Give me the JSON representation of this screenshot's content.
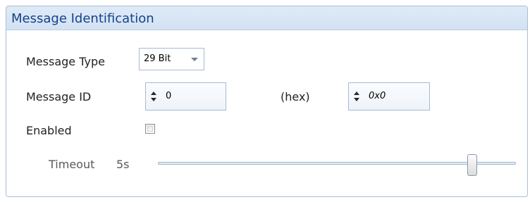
{
  "panel": {
    "title": "Message Identification"
  },
  "message_type": {
    "label": "Message Type",
    "selected": "29 Bit"
  },
  "message_id": {
    "label": "Message ID",
    "decimal_value": "0",
    "hex_label": "(hex)",
    "hex_value": "0x0"
  },
  "enabled": {
    "label": "Enabled",
    "checked": false
  },
  "timeout": {
    "label": "Timeout",
    "value_text": "5s",
    "slider_fraction": 0.87
  },
  "icons": {
    "spinner_up": "chevron-up-icon",
    "spinner_down": "chevron-down-icon",
    "dropdown": "dropdown-arrow-icon"
  },
  "colors": {
    "title_text": "#15428b",
    "header_bg": "#d9e6f5",
    "border": "#a9bdd6"
  }
}
